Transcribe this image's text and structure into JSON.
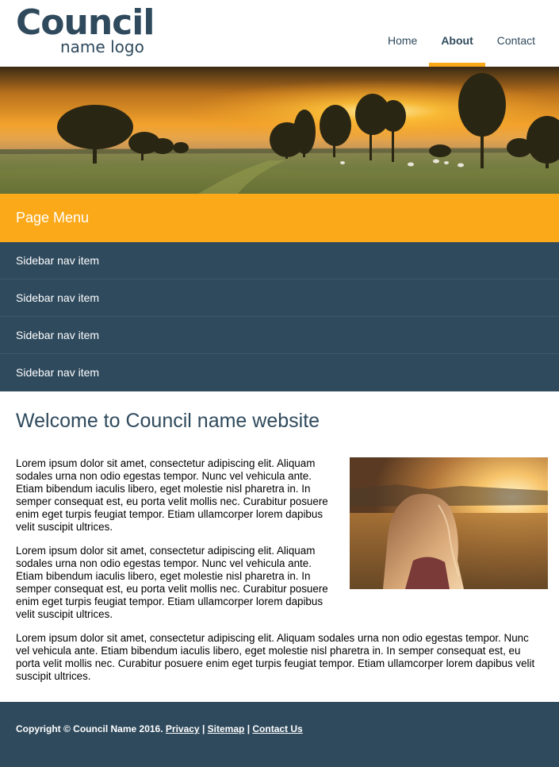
{
  "logo": {
    "main": "Council",
    "sub": "name logo"
  },
  "nav": {
    "items": [
      {
        "label": "Home"
      },
      {
        "label": "About"
      },
      {
        "label": "Contact"
      }
    ]
  },
  "sidebar": {
    "title": "Page Menu",
    "items": [
      {
        "label": "Sidebar nav item"
      },
      {
        "label": "Sidebar nav item"
      },
      {
        "label": "Sidebar nav item"
      },
      {
        "label": "Sidebar nav item"
      }
    ]
  },
  "main": {
    "title": "Welcome to Council name website",
    "paragraphs": [
      "Lorem ipsum dolor sit amet, consectetur adipiscing elit. Aliquam sodales urna non odio egestas tempor. Nunc vel vehicula ante. Etiam bibendum iaculis libero, eget molestie nisl pharetra in. In semper consequat est, eu porta velit mollis nec. Curabitur posuere enim eget turpis feugiat tempor. Etiam ullamcorper lorem dapibus velit suscipit ultrices.",
      "Lorem ipsum dolor sit amet, consectetur adipiscing elit. Aliquam sodales urna non odio egestas tempor. Nunc vel vehicula ante. Etiam bibendum iaculis libero, eget molestie nisl pharetra in. In semper consequat est, eu porta velit mollis nec. Curabitur posuere enim eget turpis feugiat tempor. Etiam ullamcorper lorem dapibus velit suscipit ultrices.",
      "Lorem ipsum dolor sit amet, consectetur adipiscing elit. Aliquam sodales urna non odio egestas tempor. Nunc vel vehicula ante. Etiam bibendum iaculis libero, eget molestie nisl pharetra in. In semper consequat est, eu porta velit mollis nec. Curabitur posuere enim eget turpis feugiat tempor. Etiam ullamcorper lorem dapibus velit suscipit ultrices."
    ]
  },
  "footer": {
    "copyright": "Copyright © Council Name 2016.",
    "links": [
      {
        "label": "Privacy"
      },
      {
        "label": "Sitemap"
      },
      {
        "label": "Contact Us"
      }
    ],
    "separator": "|"
  },
  "colors": {
    "brand": "#2f4a5d",
    "accent": "#fba919",
    "sidebar_bg": "#2f4a5d"
  }
}
